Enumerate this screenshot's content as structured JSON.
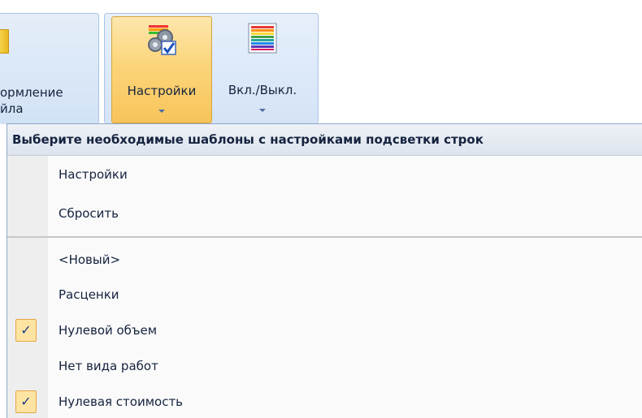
{
  "ribbon": {
    "left_group_label_line1": "ормление",
    "left_group_label_line2": "йла",
    "buttons": [
      {
        "label": "Настройки",
        "icon": "settings-gear-check-icon",
        "state": "active"
      },
      {
        "label": "Вкл./Выкл.",
        "icon": "rainbow-lines-icon",
        "state": "normal"
      }
    ]
  },
  "menu": {
    "header": "Выберите необходимые шаблоны с настройками подсветки строк",
    "actions": [
      {
        "label": "Настройки"
      },
      {
        "label": "Сбросить"
      }
    ],
    "templates": [
      {
        "label": "<Новый>",
        "checked": false
      },
      {
        "label": "Расценки",
        "checked": false
      },
      {
        "label": "Нулевой объем",
        "checked": true
      },
      {
        "label": "Нет вида работ",
        "checked": false
      },
      {
        "label": "Нулевая стоимость",
        "checked": true
      }
    ],
    "check_glyph": "✓"
  },
  "colors": {
    "active_button": "#fbd57a",
    "ribbon_bg": "#dce8f7",
    "menu_gutter": "#eeeeee",
    "check_bg": "#fde4a2"
  }
}
